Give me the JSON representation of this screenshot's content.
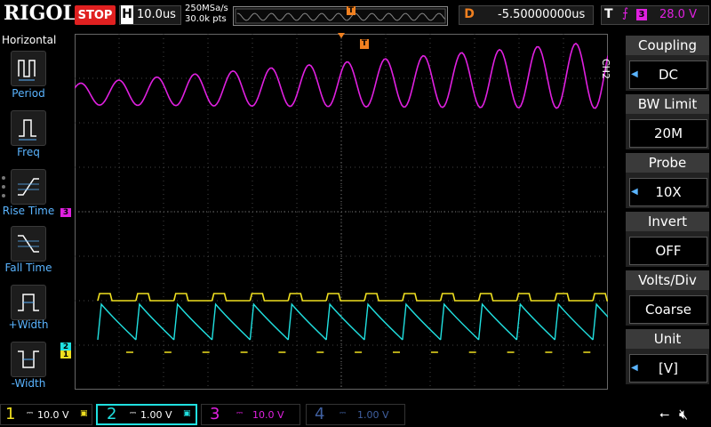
{
  "brand": "RIGOL",
  "run_status": "STOP",
  "timebase": {
    "letter": "H",
    "value": "10.0us"
  },
  "acquisition": {
    "sample_rate": "250MSa/s",
    "points": "30.0k pts"
  },
  "delay": {
    "letter": "D",
    "value": "-5.50000000us"
  },
  "trigger": {
    "letter": "T",
    "source": "3",
    "level": "28.0 V",
    "edge_icon": "rising-edge-icon"
  },
  "trigger_marker": "T",
  "left_menu": {
    "title": "Horizontal",
    "items": [
      {
        "label": "Period",
        "icon": "period-icon"
      },
      {
        "label": "Freq",
        "icon": "freq-icon"
      },
      {
        "label": "Rise Time",
        "icon": "rise-time-icon"
      },
      {
        "label": "Fall Time",
        "icon": "fall-time-icon"
      },
      {
        "label": "+Width",
        "icon": "pos-width-icon"
      },
      {
        "label": "-Width",
        "icon": "neg-width-icon"
      }
    ]
  },
  "right_menu": {
    "channel": "CH2",
    "items": [
      {
        "label": "Coupling",
        "value": "DC",
        "has_arrow": true
      },
      {
        "label": "BW Limit",
        "value": "20M",
        "has_arrow": false
      },
      {
        "label": "Probe",
        "value": "10X",
        "has_arrow": true
      },
      {
        "label": "Invert",
        "value": "OFF",
        "has_arrow": false
      },
      {
        "label": "Volts/Div",
        "value": "Coarse",
        "has_arrow": false
      },
      {
        "label": "Unit",
        "value": "[V]",
        "has_arrow": true
      }
    ]
  },
  "channels": [
    {
      "num": "1",
      "scale": "10.0 V",
      "color": "#f0e020"
    },
    {
      "num": "2",
      "scale": "1.00 V",
      "color": "#20e0e0"
    },
    {
      "num": "3",
      "scale": "10.0 V",
      "color": "#e020e0"
    },
    {
      "num": "4",
      "scale": "1.00 V",
      "color": "#4060a0"
    }
  ],
  "channel_markers": {
    "ch3": "3",
    "ch2": "2",
    "ch1": "1"
  },
  "colors": {
    "ch1": "#f0e020",
    "ch2": "#20e0e0",
    "ch3": "#e020e0",
    "ch4": "#4060a0",
    "trigger": "#f08020",
    "stop": "#e02020",
    "menu_text": "#5ab4ff"
  },
  "status_icons": [
    "usb-icon",
    "mute-icon"
  ]
}
